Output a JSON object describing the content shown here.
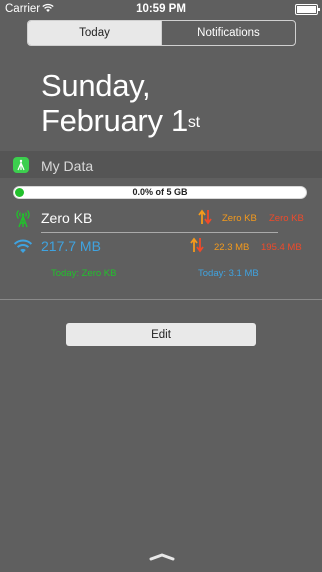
{
  "status_bar": {
    "carrier": "Carrier",
    "time": "10:59 PM"
  },
  "tabs": [
    {
      "label": "Today",
      "active": true
    },
    {
      "label": "Notifications",
      "active": false
    }
  ],
  "date": {
    "line1": "Sunday,",
    "line2": "February 1",
    "suffix": "st"
  },
  "widget": {
    "app_name": "My Data",
    "progress": {
      "label": "0.0% of 5 GB",
      "fraction": 0.0
    },
    "cellular": {
      "total": "Zero KB",
      "up": "Zero KB",
      "down": "Zero KB",
      "today": "Today: Zero KB"
    },
    "wifi": {
      "total": "217.7 MB",
      "up": "22.3 MB",
      "down": "195.4 MB",
      "today": "Today: 3.1 MB"
    }
  },
  "edit_label": "Edit",
  "colors": {
    "green": "#22c02c",
    "wifi_blue": "#3fa3e0",
    "up_orange": "#f49a1c",
    "down_red": "#ef4a2a"
  }
}
